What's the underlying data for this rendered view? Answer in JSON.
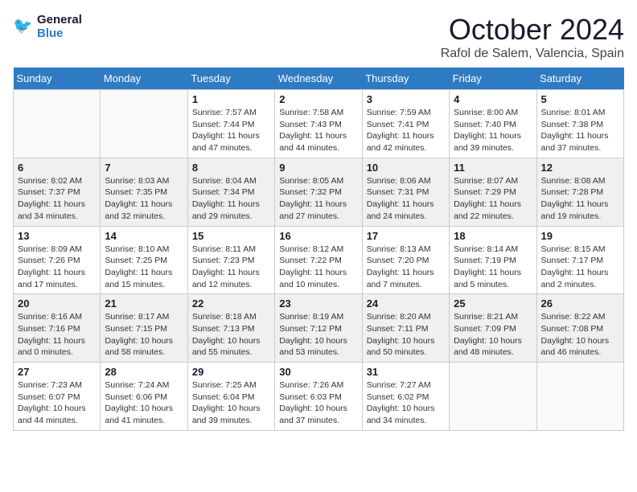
{
  "header": {
    "logo_line1": "General",
    "logo_line2": "Blue",
    "month": "October 2024",
    "location": "Rafol de Salem, Valencia, Spain"
  },
  "weekdays": [
    "Sunday",
    "Monday",
    "Tuesday",
    "Wednesday",
    "Thursday",
    "Friday",
    "Saturday"
  ],
  "weeks": [
    [
      {
        "day": "",
        "info": ""
      },
      {
        "day": "",
        "info": ""
      },
      {
        "day": "1",
        "info": "Sunrise: 7:57 AM\nSunset: 7:44 PM\nDaylight: 11 hours\nand 47 minutes."
      },
      {
        "day": "2",
        "info": "Sunrise: 7:58 AM\nSunset: 7:43 PM\nDaylight: 11 hours\nand 44 minutes."
      },
      {
        "day": "3",
        "info": "Sunrise: 7:59 AM\nSunset: 7:41 PM\nDaylight: 11 hours\nand 42 minutes."
      },
      {
        "day": "4",
        "info": "Sunrise: 8:00 AM\nSunset: 7:40 PM\nDaylight: 11 hours\nand 39 minutes."
      },
      {
        "day": "5",
        "info": "Sunrise: 8:01 AM\nSunset: 7:38 PM\nDaylight: 11 hours\nand 37 minutes."
      }
    ],
    [
      {
        "day": "6",
        "info": "Sunrise: 8:02 AM\nSunset: 7:37 PM\nDaylight: 11 hours\nand 34 minutes."
      },
      {
        "day": "7",
        "info": "Sunrise: 8:03 AM\nSunset: 7:35 PM\nDaylight: 11 hours\nand 32 minutes."
      },
      {
        "day": "8",
        "info": "Sunrise: 8:04 AM\nSunset: 7:34 PM\nDaylight: 11 hours\nand 29 minutes."
      },
      {
        "day": "9",
        "info": "Sunrise: 8:05 AM\nSunset: 7:32 PM\nDaylight: 11 hours\nand 27 minutes."
      },
      {
        "day": "10",
        "info": "Sunrise: 8:06 AM\nSunset: 7:31 PM\nDaylight: 11 hours\nand 24 minutes."
      },
      {
        "day": "11",
        "info": "Sunrise: 8:07 AM\nSunset: 7:29 PM\nDaylight: 11 hours\nand 22 minutes."
      },
      {
        "day": "12",
        "info": "Sunrise: 8:08 AM\nSunset: 7:28 PM\nDaylight: 11 hours\nand 19 minutes."
      }
    ],
    [
      {
        "day": "13",
        "info": "Sunrise: 8:09 AM\nSunset: 7:26 PM\nDaylight: 11 hours\nand 17 minutes."
      },
      {
        "day": "14",
        "info": "Sunrise: 8:10 AM\nSunset: 7:25 PM\nDaylight: 11 hours\nand 15 minutes."
      },
      {
        "day": "15",
        "info": "Sunrise: 8:11 AM\nSunset: 7:23 PM\nDaylight: 11 hours\nand 12 minutes."
      },
      {
        "day": "16",
        "info": "Sunrise: 8:12 AM\nSunset: 7:22 PM\nDaylight: 11 hours\nand 10 minutes."
      },
      {
        "day": "17",
        "info": "Sunrise: 8:13 AM\nSunset: 7:20 PM\nDaylight: 11 hours\nand 7 minutes."
      },
      {
        "day": "18",
        "info": "Sunrise: 8:14 AM\nSunset: 7:19 PM\nDaylight: 11 hours\nand 5 minutes."
      },
      {
        "day": "19",
        "info": "Sunrise: 8:15 AM\nSunset: 7:17 PM\nDaylight: 11 hours\nand 2 minutes."
      }
    ],
    [
      {
        "day": "20",
        "info": "Sunrise: 8:16 AM\nSunset: 7:16 PM\nDaylight: 11 hours\nand 0 minutes."
      },
      {
        "day": "21",
        "info": "Sunrise: 8:17 AM\nSunset: 7:15 PM\nDaylight: 10 hours\nand 58 minutes."
      },
      {
        "day": "22",
        "info": "Sunrise: 8:18 AM\nSunset: 7:13 PM\nDaylight: 10 hours\nand 55 minutes."
      },
      {
        "day": "23",
        "info": "Sunrise: 8:19 AM\nSunset: 7:12 PM\nDaylight: 10 hours\nand 53 minutes."
      },
      {
        "day": "24",
        "info": "Sunrise: 8:20 AM\nSunset: 7:11 PM\nDaylight: 10 hours\nand 50 minutes."
      },
      {
        "day": "25",
        "info": "Sunrise: 8:21 AM\nSunset: 7:09 PM\nDaylight: 10 hours\nand 48 minutes."
      },
      {
        "day": "26",
        "info": "Sunrise: 8:22 AM\nSunset: 7:08 PM\nDaylight: 10 hours\nand 46 minutes."
      }
    ],
    [
      {
        "day": "27",
        "info": "Sunrise: 7:23 AM\nSunset: 6:07 PM\nDaylight: 10 hours\nand 44 minutes."
      },
      {
        "day": "28",
        "info": "Sunrise: 7:24 AM\nSunset: 6:06 PM\nDaylight: 10 hours\nand 41 minutes."
      },
      {
        "day": "29",
        "info": "Sunrise: 7:25 AM\nSunset: 6:04 PM\nDaylight: 10 hours\nand 39 minutes."
      },
      {
        "day": "30",
        "info": "Sunrise: 7:26 AM\nSunset: 6:03 PM\nDaylight: 10 hours\nand 37 minutes."
      },
      {
        "day": "31",
        "info": "Sunrise: 7:27 AM\nSunset: 6:02 PM\nDaylight: 10 hours\nand 34 minutes."
      },
      {
        "day": "",
        "info": ""
      },
      {
        "day": "",
        "info": ""
      }
    ]
  ]
}
